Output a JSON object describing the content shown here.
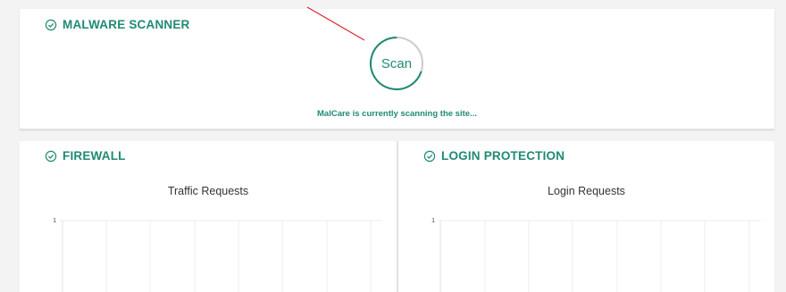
{
  "scanner": {
    "title": "MALWARE SCANNER",
    "scan_button": "Scan",
    "status": "MalCare is currently scanning the site...",
    "scan_progress": 0.3
  },
  "firewall": {
    "title": "FIREWALL",
    "chart_title": "Traffic Requests",
    "y_tick": "1"
  },
  "login_protection": {
    "title": "LOGIN PROTECTION",
    "chart_title": "Login Requests",
    "y_tick": "1"
  },
  "colors": {
    "accent": "#1f8a74",
    "arrow": "#d9272e"
  }
}
